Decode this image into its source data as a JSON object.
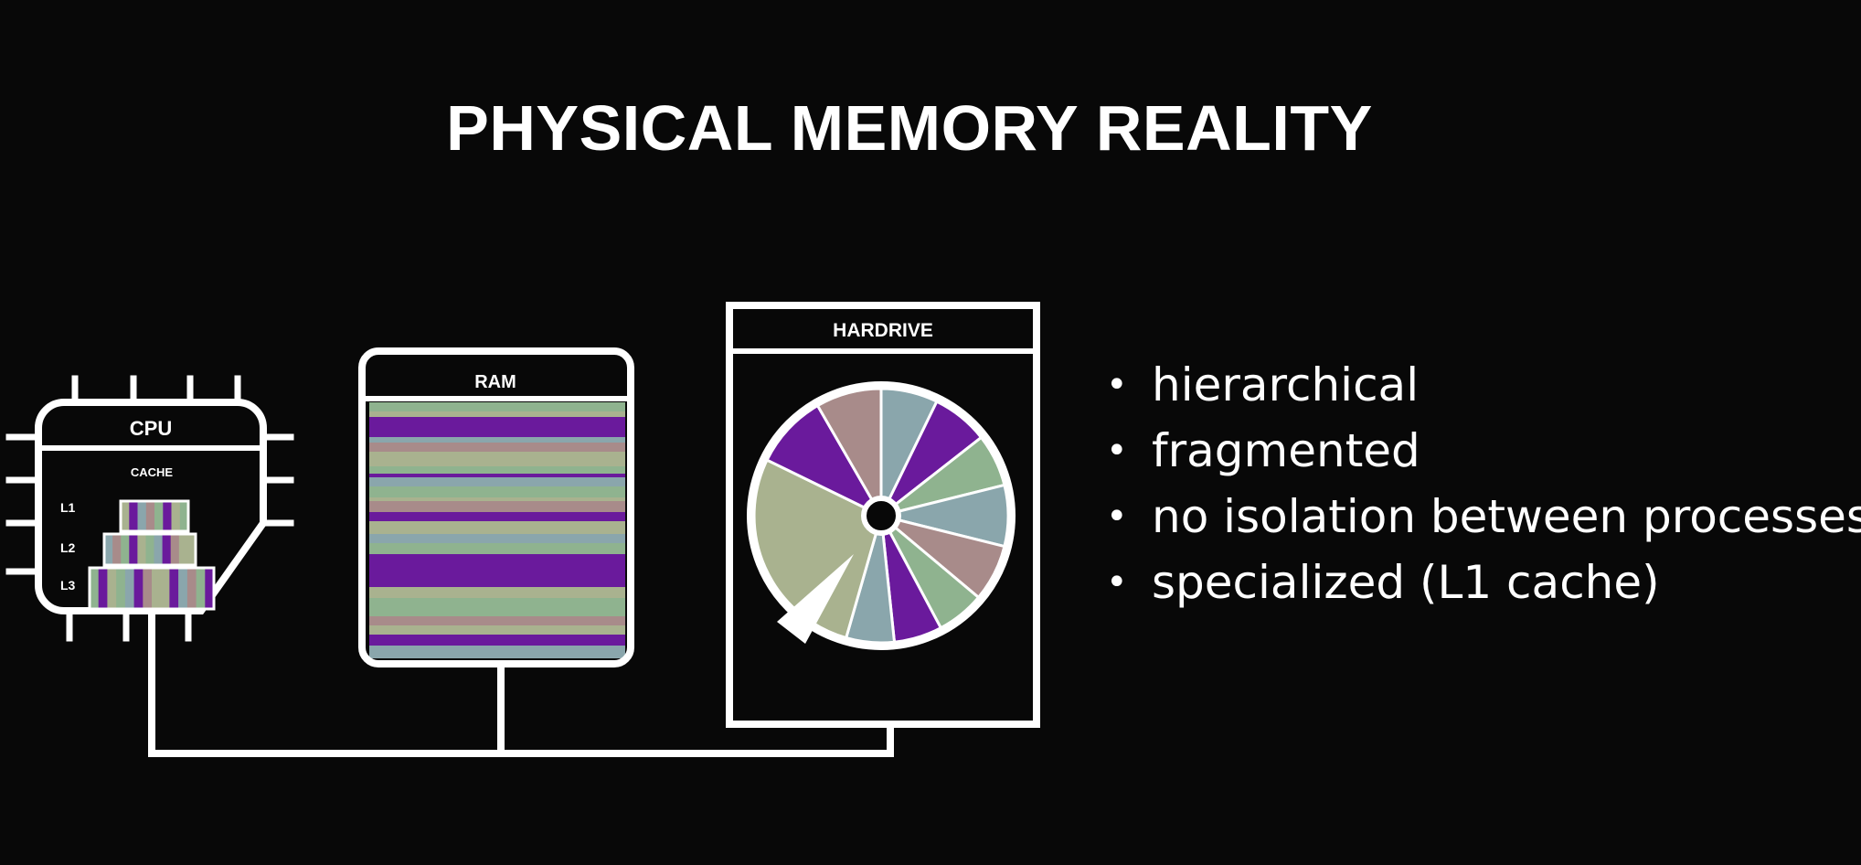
{
  "title": "PHYSICAL MEMORY REALITY",
  "diagram": {
    "cpu": {
      "label": "CPU",
      "cache_label": "CACHE",
      "levels": [
        "L1",
        "L2",
        "L3"
      ]
    },
    "ram": {
      "label": "RAM"
    },
    "hardrive": {
      "label": "HARDRIVE"
    }
  },
  "bullets": [
    "hierarchical",
    "fragmented",
    "no isolation between processes",
    "specialized (L1 cache)"
  ],
  "colors": {
    "background": "#080808",
    "outline": "#ffffff",
    "purple": "#6a1a9c",
    "sage": "#a9b28f",
    "green": "#8fb38f",
    "blue_grey": "#8aa6ac",
    "mauve": "#a88b8a"
  }
}
